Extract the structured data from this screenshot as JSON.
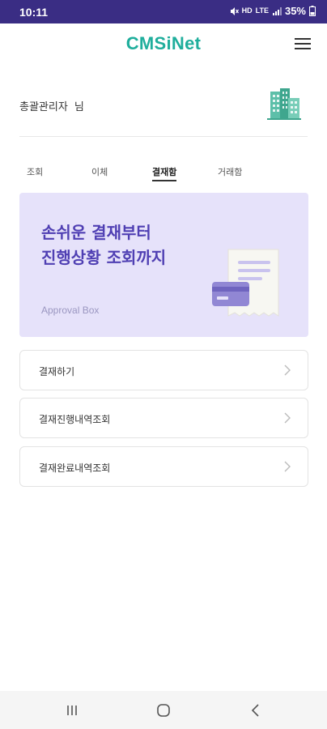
{
  "status": {
    "time": "10:11",
    "network_hd": "HD",
    "network_lte": "LTE",
    "battery": "35%"
  },
  "header": {
    "logo": "CMSiNet",
    "menu_icon": "hamburger-menu-icon"
  },
  "user": {
    "name": "총괄관리자",
    "suffix": "님",
    "icon": "building-icon"
  },
  "tabs": [
    {
      "label": "조회"
    },
    {
      "label": "이체"
    },
    {
      "label": "결재함"
    },
    {
      "label": "거래함"
    }
  ],
  "active_tab": "결재함",
  "banner": {
    "line1": "손쉬운 결재부터",
    "line2": "진행상황 조회까지",
    "subtitle": "Approval Box",
    "illustration": "receipt-card-icon"
  },
  "menu_items": [
    {
      "label": "결재하기"
    },
    {
      "label": "결재진행내역조회"
    },
    {
      "label": "결재완료내역조회"
    }
  ],
  "colors": {
    "status_bar": "#3a2d84",
    "brand": "#1fae9c",
    "banner_bg": "#e6e2fa",
    "banner_text": "#4f3fb3"
  },
  "nav": {
    "recent_icon": "recent-apps-icon",
    "home_icon": "home-icon",
    "back_icon": "back-icon"
  }
}
